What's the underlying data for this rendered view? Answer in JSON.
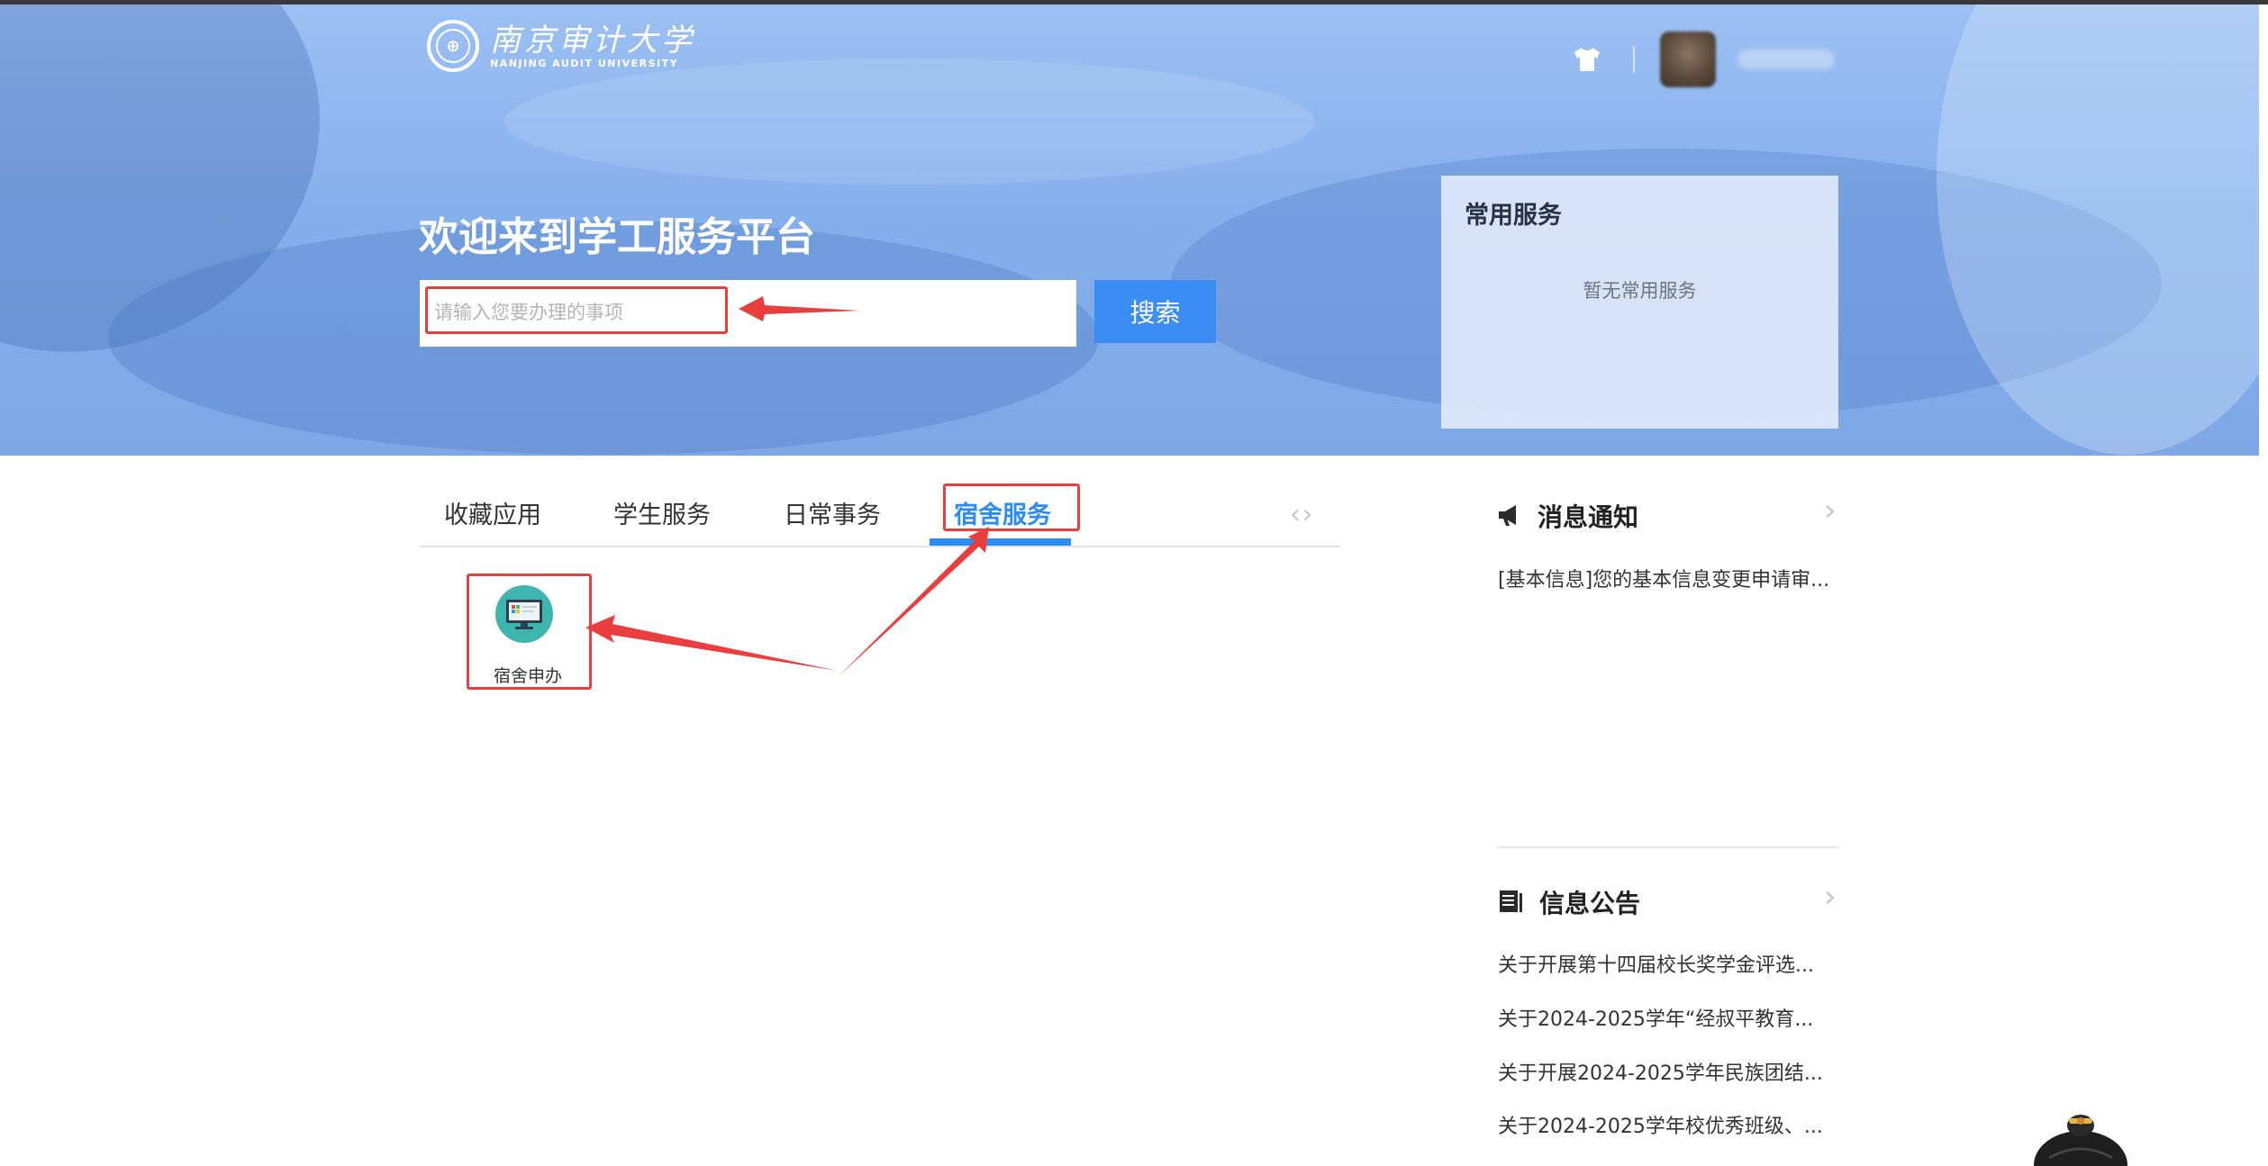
{
  "header": {
    "university_name_cn": "南京审计大学",
    "university_name_en": "NANJING AUDIT UNIVERSITY",
    "icons": [
      "shirt-icon",
      "avatar"
    ]
  },
  "hero": {
    "welcome": "欢迎来到学工服务平台",
    "search": {
      "placeholder": "请输入您要办理的事项",
      "value": "",
      "button": "搜索"
    },
    "common_services": {
      "title": "常用服务",
      "empty_text": "暂无常用服务"
    }
  },
  "tabs": {
    "items": [
      {
        "label": "收藏应用",
        "active": false
      },
      {
        "label": "学生服务",
        "active": false
      },
      {
        "label": "日常事务",
        "active": false
      },
      {
        "label": "宿舍服务",
        "active": true
      }
    ],
    "nav_prev": "‹",
    "nav_next": "›"
  },
  "apps": [
    {
      "label": "宿舍申办",
      "icon": "monitor-icon"
    }
  ],
  "notifications": {
    "title": "消息通知",
    "icon": "megaphone-icon",
    "items": [
      "[基本信息]您的基本信息变更申请审..."
    ]
  },
  "announcements": {
    "title": "信息公告",
    "icon": "document-icon",
    "items": [
      "关于开展第十四届校长奖学金评选...",
      "关于2024-2025学年“经叔平教育...",
      "关于开展2024-2025学年民族团结...",
      "关于2024-2025学年校优秀班级、..."
    ]
  },
  "colors": {
    "primary": "#2d8cf0",
    "button": "#3b8cf5",
    "annotation": "#ea3e3e"
  }
}
